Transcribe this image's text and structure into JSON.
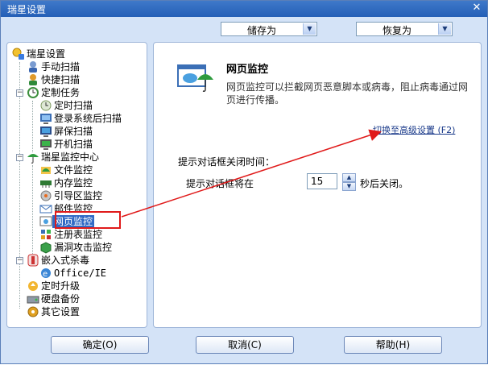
{
  "window": {
    "title": "瑞星设置",
    "close_glyph": "✕"
  },
  "toolbar": {
    "save_as": "储存为",
    "restore_as": "恢复为"
  },
  "tree": {
    "root": "瑞星设置",
    "items": [
      {
        "label": "手动扫描",
        "icon": "manual-scan-icon"
      },
      {
        "label": "快捷扫描",
        "icon": "quick-scan-icon"
      },
      {
        "label": "定制任务",
        "icon": "scheduled-task-icon"
      },
      {
        "label": "定时扫描",
        "icon": "timer-scan-icon"
      },
      {
        "label": "登录系统后扫描",
        "icon": "login-scan-icon"
      },
      {
        "label": "屏保扫描",
        "icon": "screensaver-scan-icon"
      },
      {
        "label": "开机扫描",
        "icon": "startup-scan-icon"
      },
      {
        "label": "瑞星监控中心",
        "icon": "monitor-center-icon"
      },
      {
        "label": "文件监控",
        "icon": "file-monitor-icon"
      },
      {
        "label": "内存监控",
        "icon": "memory-monitor-icon"
      },
      {
        "label": "引导区监控",
        "icon": "boot-monitor-icon"
      },
      {
        "label": "邮件监控",
        "icon": "mail-monitor-icon"
      },
      {
        "label": "网页监控",
        "icon": "web-monitor-icon"
      },
      {
        "label": "注册表监控",
        "icon": "registry-monitor-icon"
      },
      {
        "label": "漏洞攻击监控",
        "icon": "exploit-monitor-icon"
      },
      {
        "label": "嵌入式杀毒",
        "icon": "embedded-av-icon"
      },
      {
        "label": "Office/IE",
        "icon": "office-ie-icon"
      },
      {
        "label": "定时升级",
        "icon": "update-icon"
      },
      {
        "label": "硬盘备份",
        "icon": "disk-backup-icon"
      },
      {
        "label": "其它设置",
        "icon": "other-settings-icon"
      }
    ],
    "selected": "网页监控"
  },
  "panel": {
    "title": "网页监控",
    "description": "网页监控可以拦截网页恶意脚本或病毒，阻止病毒通过网页进行传播。",
    "advanced_link": "切换至高级设置 (F2)",
    "section_label": "提示对话框关闭时间：",
    "prompt_label": "提示对话框将在",
    "seconds_value": "15",
    "suffix_label": "秒后关闭。"
  },
  "buttons": {
    "ok": "确定(O)",
    "cancel": "取消(C)",
    "help": "帮助(H)"
  },
  "colors": {
    "title_bar": "#245fb7",
    "window_bg": "#d4e3f7",
    "selection": "#316ac5",
    "annotation_red": "#e01a1a"
  }
}
